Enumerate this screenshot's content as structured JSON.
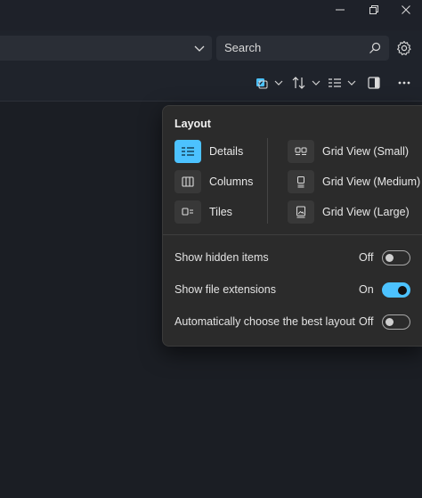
{
  "titlebar": {
    "minimize": "minimize-icon",
    "maximize": "restore-icon",
    "close": "close-icon"
  },
  "search": {
    "placeholder": "Search"
  },
  "commandbar": {
    "icons": [
      "select-checkbox-icon",
      "sort-icon",
      "view-list-icon",
      "details-pane-icon",
      "more-icon"
    ]
  },
  "layout_flyout": {
    "title": "Layout",
    "left_options": [
      {
        "label": "Details",
        "selected": true,
        "icon": "details-view-icon"
      },
      {
        "label": "Columns",
        "selected": false,
        "icon": "columns-view-icon"
      },
      {
        "label": "Tiles",
        "selected": false,
        "icon": "tiles-view-icon"
      }
    ],
    "right_options": [
      {
        "label": "Grid View (Small)",
        "icon": "grid-small-icon"
      },
      {
        "label": "Grid View (Medium)",
        "icon": "grid-medium-icon"
      },
      {
        "label": "Grid View (Large)",
        "icon": "grid-large-icon"
      }
    ],
    "toggles": [
      {
        "label": "Show hidden items",
        "state": "Off",
        "on": false
      },
      {
        "label": "Show file extensions",
        "state": "On",
        "on": true
      },
      {
        "label": "Automatically choose the best layout",
        "state": "Off",
        "on": false
      }
    ]
  },
  "colors": {
    "accent": "#4cc2ff",
    "flyout_bg": "#2b2b2b",
    "window_bg": "#1b1e24"
  }
}
